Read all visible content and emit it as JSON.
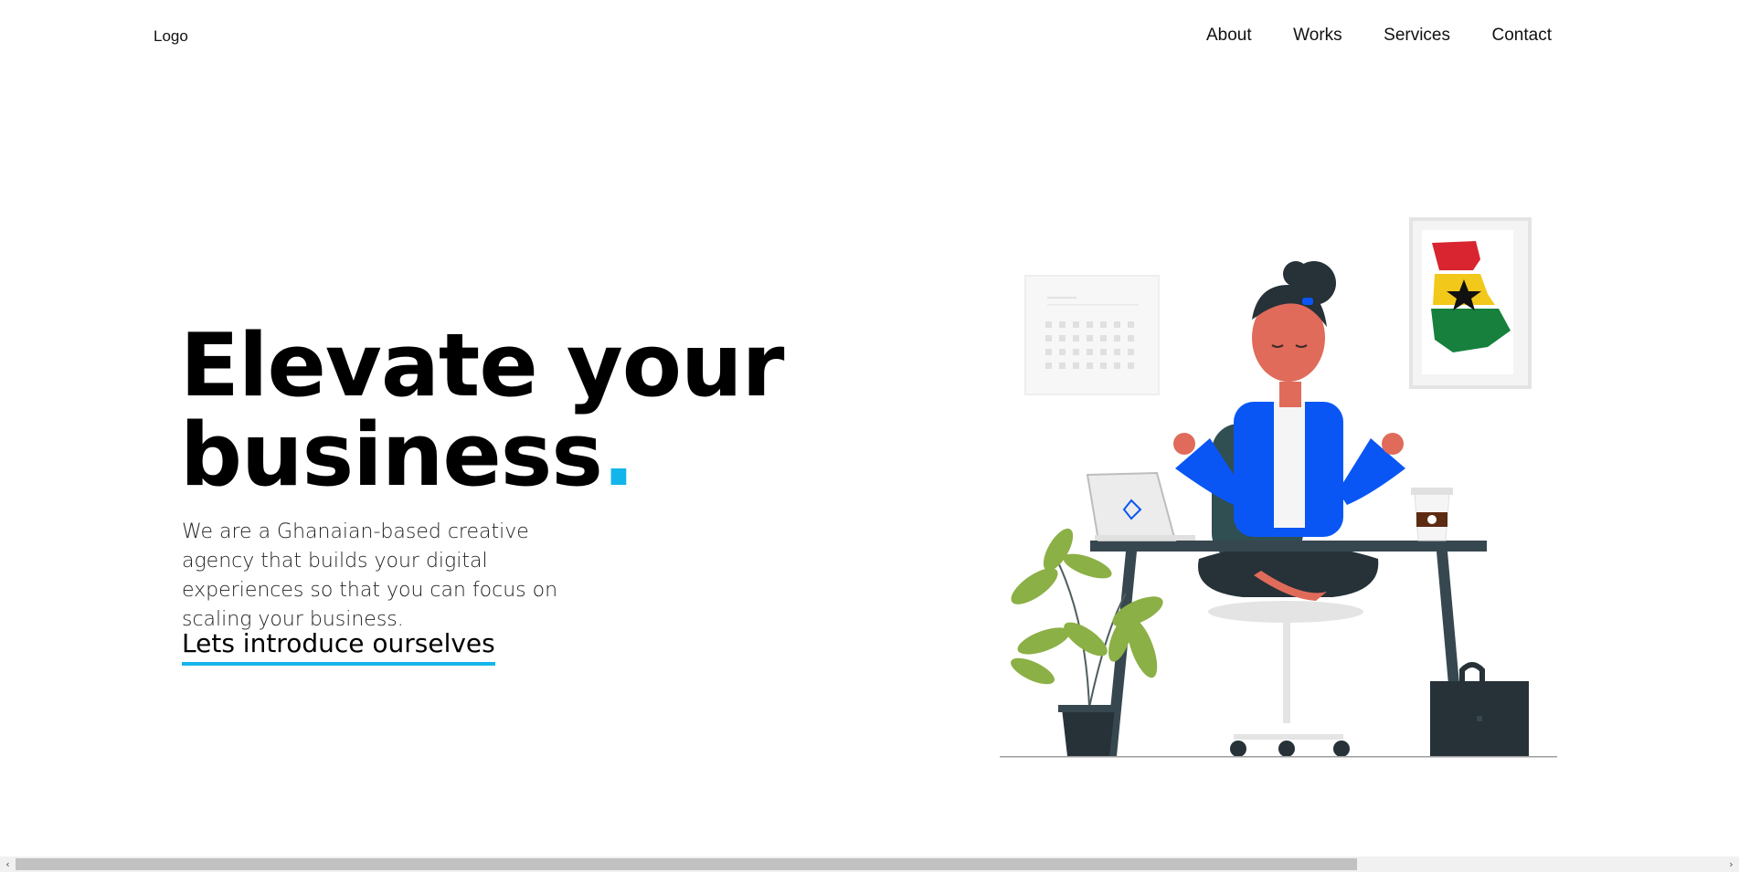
{
  "nav": {
    "logo": "Logo",
    "links": [
      {
        "label": "About"
      },
      {
        "label": "Works"
      },
      {
        "label": "Services"
      },
      {
        "label": "Contact"
      }
    ]
  },
  "hero": {
    "title_line1": "Elevate your",
    "title_line2": "business",
    "title_dot": ".",
    "description": "We are a Ghanaian-based creative agency that builds your digital experiences so that you can focus on scaling your business.",
    "cta": "Lets introduce ourselves"
  },
  "scrollbar": {
    "left_arrow": "‹",
    "right_arrow": "›",
    "position": 0.0,
    "visible_fraction": 0.78
  },
  "colors": {
    "accent": "#13b5ea",
    "jacket": "#0a56f5",
    "desk": "#37474f",
    "plant": "#8bb046",
    "flag_red": "#d8252f",
    "flag_yellow": "#f2c81a",
    "flag_green": "#16803c"
  }
}
